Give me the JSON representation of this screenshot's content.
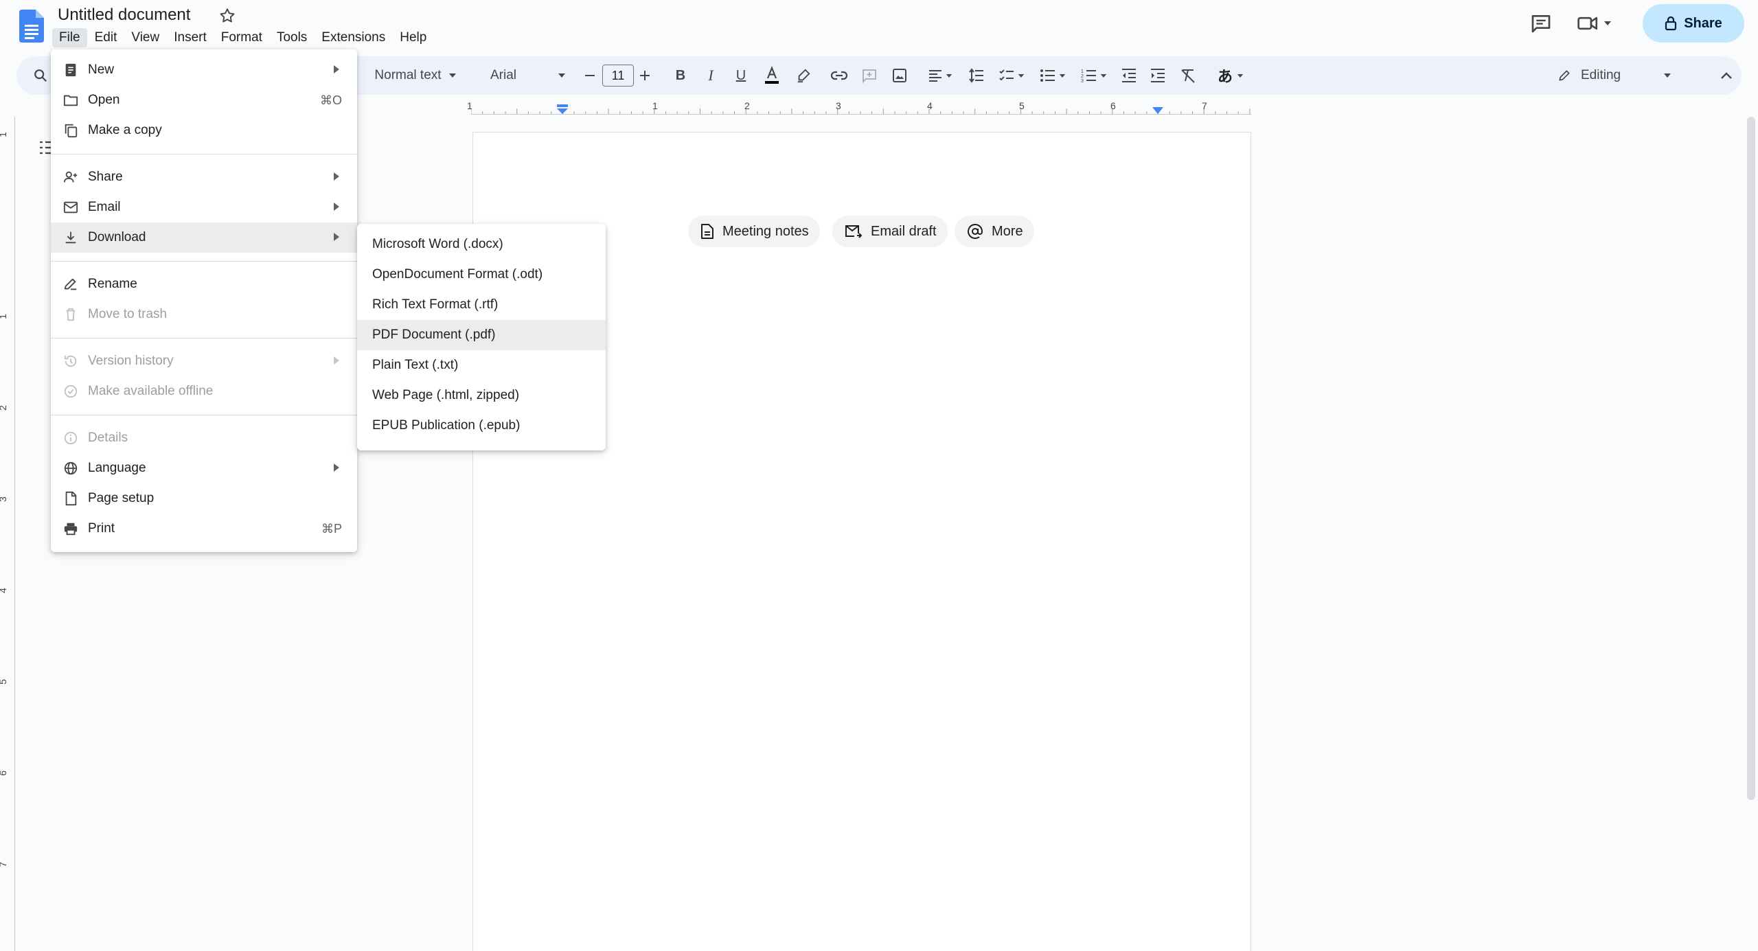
{
  "document": {
    "title": "Untitled document"
  },
  "menubar": {
    "items": [
      "File",
      "Edit",
      "View",
      "Insert",
      "Format",
      "Tools",
      "Extensions",
      "Help"
    ],
    "active": "File"
  },
  "header": {
    "share_label": "Share"
  },
  "toolbar": {
    "style": "Normal text",
    "font": "Arial",
    "font_size": "11",
    "mode": "Editing",
    "text_color": "#000000"
  },
  "ruler": {
    "numbers": [
      "1",
      "1",
      "2",
      "3",
      "4",
      "5",
      "6",
      "7"
    ]
  },
  "left_ruler": {
    "numbers": [
      "1",
      "1",
      "2",
      "3",
      "4",
      "5",
      "6",
      "7"
    ]
  },
  "chips": [
    {
      "label": "Meeting notes",
      "icon": "document-icon"
    },
    {
      "label": "Email draft",
      "icon": "mail-icon"
    },
    {
      "label": "More",
      "icon": "at-sign-icon"
    }
  ],
  "file_menu": {
    "items": [
      {
        "label": "New",
        "icon": "document-filled-icon",
        "submenu": true,
        "disabled": false
      },
      {
        "label": "Open",
        "icon": "folder-icon",
        "shortcut": "⌘O",
        "disabled": false
      },
      {
        "label": "Make a copy",
        "icon": "copy-icon",
        "disabled": false
      },
      {
        "label": "Share",
        "icon": "person-add-icon",
        "submenu": true,
        "disabled": false
      },
      {
        "label": "Email",
        "icon": "mail-icon",
        "submenu": true,
        "disabled": false
      },
      {
        "label": "Download",
        "icon": "download-icon",
        "submenu": true,
        "disabled": false,
        "highlighted": true
      },
      {
        "label": "Rename",
        "icon": "rename-icon",
        "disabled": false
      },
      {
        "label": "Move to trash",
        "icon": "trash-icon",
        "disabled": true
      },
      {
        "label": "Version history",
        "icon": "history-icon",
        "submenu": true,
        "disabled": true
      },
      {
        "label": "Make available offline",
        "icon": "offline-icon",
        "disabled": true
      },
      {
        "label": "Details",
        "icon": "info-icon",
        "disabled": true
      },
      {
        "label": "Language",
        "icon": "globe-icon",
        "submenu": true,
        "disabled": false
      },
      {
        "label": "Page setup",
        "icon": "page-setup-icon",
        "disabled": false
      },
      {
        "label": "Print",
        "icon": "printer-icon",
        "shortcut": "⌘P",
        "disabled": false
      }
    ]
  },
  "download_menu": {
    "items": [
      "Microsoft Word (.docx)",
      "OpenDocument Format (.odt)",
      "Rich Text Format (.rtf)",
      "PDF Document (.pdf)",
      "Plain Text (.txt)",
      "Web Page (.html, zipped)",
      "EPUB Publication (.epub)"
    ],
    "highlighted_index": 3
  },
  "colors": {
    "accent": "#0b57d0",
    "share_bg": "#c2e7ff",
    "toolbar_bg": "#edf2fa",
    "docs_blue": "#4285f4"
  }
}
